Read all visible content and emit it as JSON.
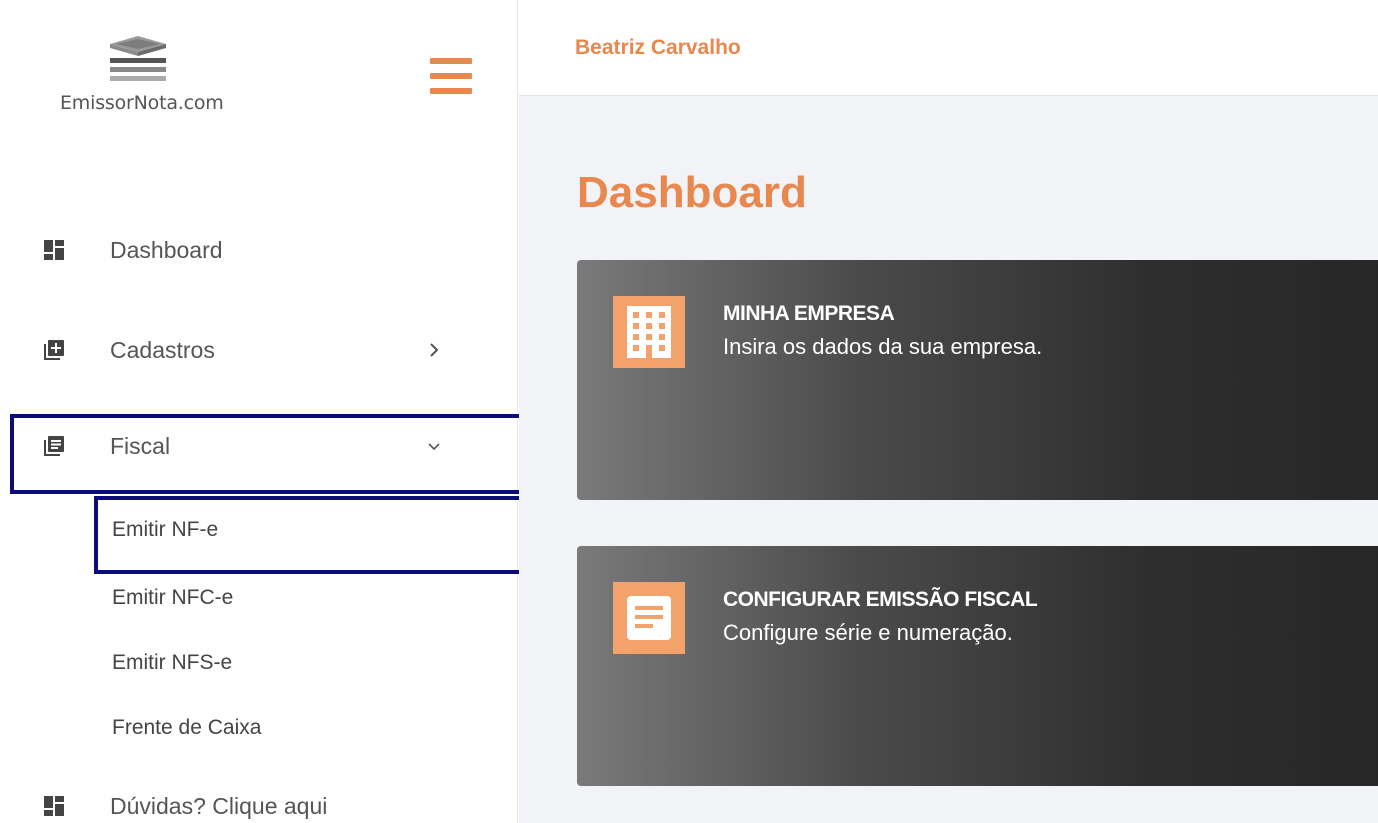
{
  "app": {
    "logo_text": "EmissorNota.com"
  },
  "header": {
    "user_name": "Beatriz Carvalho"
  },
  "sidebar": {
    "items": [
      {
        "label": "Dashboard",
        "icon": "dashboard-icon"
      },
      {
        "label": "Cadastros",
        "icon": "add-box-icon",
        "chevron": "chevron-right-icon"
      },
      {
        "label": "Fiscal",
        "icon": "library-books-icon",
        "chevron": "chevron-down-icon",
        "expanded": true
      },
      {
        "label": "Dúvidas? Clique aqui",
        "icon": "dashboard-icon"
      }
    ],
    "fiscal_subitems": [
      {
        "label": "Emitir NF-e"
      },
      {
        "label": "Emitir NFC-e"
      },
      {
        "label": "Emitir NFS-e"
      },
      {
        "label": "Frente de Caixa"
      }
    ]
  },
  "main": {
    "page_title": "Dashboard",
    "cards": [
      {
        "title": "MINHA EMPRESA",
        "description": "Insira os dados da sua empresa.",
        "icon": "building-icon"
      },
      {
        "title": "CONFIGURAR EMISSÃO FISCAL",
        "description": "Configure série e numeração.",
        "icon": "document-icon"
      }
    ]
  },
  "colors": {
    "accent": "#e8874e",
    "card_icon_bg": "#f4a26b",
    "highlight_border": "#0b0b7a",
    "main_bg": "#f2f3f7"
  }
}
